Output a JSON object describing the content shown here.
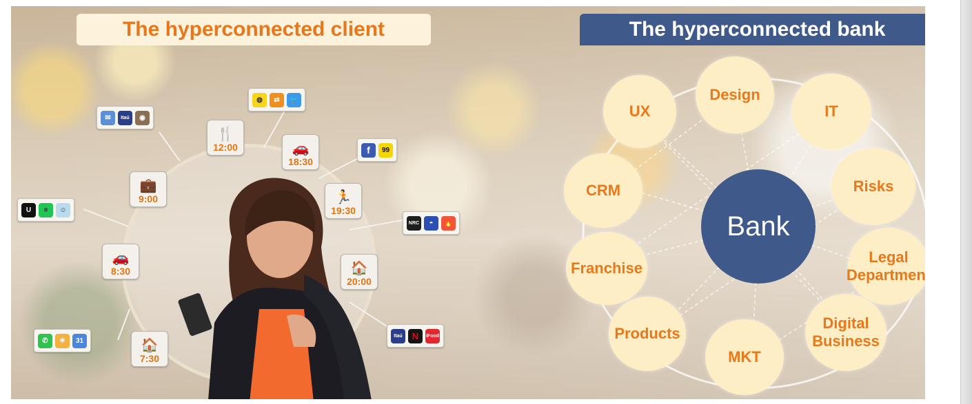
{
  "titles": {
    "client": "The hyperconnected client",
    "bank": "The hyperconnected bank"
  },
  "timeline": [
    {
      "time": "12:00",
      "icon": "restaurant-icon",
      "symbol": "🍴"
    },
    {
      "time": "18:30",
      "icon": "car-icon",
      "symbol": "🚗"
    },
    {
      "time": "19:30",
      "icon": "runner-icon",
      "symbol": "🏃"
    },
    {
      "time": "20:00",
      "icon": "house-icon",
      "symbol": "🏠"
    },
    {
      "time": "9:00",
      "icon": "briefcase-icon",
      "symbol": "💼"
    },
    {
      "time": "8:30",
      "icon": "car-icon",
      "symbol": "🚗"
    },
    {
      "time": "7:30",
      "icon": "house-icon",
      "symbol": "🏠"
    }
  ],
  "app_groups": [
    {
      "name": "mail-itau-instagram",
      "apps": [
        {
          "icon": "mail-icon",
          "label": "✉",
          "color": "#5b8fd6"
        },
        {
          "icon": "itau-icon",
          "label": "Itaú",
          "color": "#2a3e8c"
        },
        {
          "icon": "instagram-icon",
          "label": "◉",
          "color": "#8a6f55"
        }
      ]
    },
    {
      "name": "snapchat-transfer-twitter",
      "apps": [
        {
          "icon": "snapchat-icon",
          "label": "◍",
          "color": "#f7d51c"
        },
        {
          "icon": "transfer-icon",
          "label": "⇄",
          "color": "#ef8f1f"
        },
        {
          "icon": "twitter-icon",
          "label": "🐦",
          "color": "#3d9ae8"
        }
      ]
    },
    {
      "name": "facebook-99",
      "apps": [
        {
          "icon": "facebook-icon",
          "label": "f",
          "color": "#3b5bb0"
        },
        {
          "icon": "99-taxi-icon",
          "label": "99",
          "color": "#f6d600"
        }
      ]
    },
    {
      "name": "uber-spotify-waze",
      "apps": [
        {
          "icon": "uber-icon",
          "label": "U",
          "color": "#111111"
        },
        {
          "icon": "spotify-icon",
          "label": "≡",
          "color": "#1ec653"
        },
        {
          "icon": "waze-icon",
          "label": "☺",
          "color": "#b9dbef"
        }
      ]
    },
    {
      "name": "nrc-pokeball-tinder",
      "apps": [
        {
          "icon": "nike-run-club-icon",
          "label": "NRC",
          "color": "#1e1e1e"
        },
        {
          "icon": "pokemon-go-icon",
          "label": "◓",
          "color": "#2b4fb2"
        },
        {
          "icon": "tinder-icon",
          "label": "🔥",
          "color": "#f0543a"
        }
      ]
    },
    {
      "name": "whatsapp-weather-calendar",
      "apps": [
        {
          "icon": "whatsapp-icon",
          "label": "✆",
          "color": "#2fc24f"
        },
        {
          "icon": "weather-icon",
          "label": "☀",
          "color": "#f3b240"
        },
        {
          "icon": "calendar-icon",
          "label": "31",
          "color": "#4a86d9"
        }
      ]
    },
    {
      "name": "itau-netflix-ifood",
      "apps": [
        {
          "icon": "itau-icon",
          "label": "Itaú",
          "color": "#2a3e8c"
        },
        {
          "icon": "netflix-icon",
          "label": "N",
          "color": "#141414"
        },
        {
          "icon": "ifood-icon",
          "label": "iFood",
          "color": "#e4262f"
        }
      ]
    }
  ],
  "bank": {
    "center": "Bank",
    "departments": [
      "UX",
      "Design",
      "IT",
      "CRM",
      "Risks",
      "Franchise",
      "Legal Department",
      "Products",
      "Digital Business",
      "MKT"
    ]
  },
  "colors": {
    "accent_orange": "#e8761a",
    "bank_blue": "#3f5a8a",
    "bubble_fill": "#fdeec5"
  }
}
